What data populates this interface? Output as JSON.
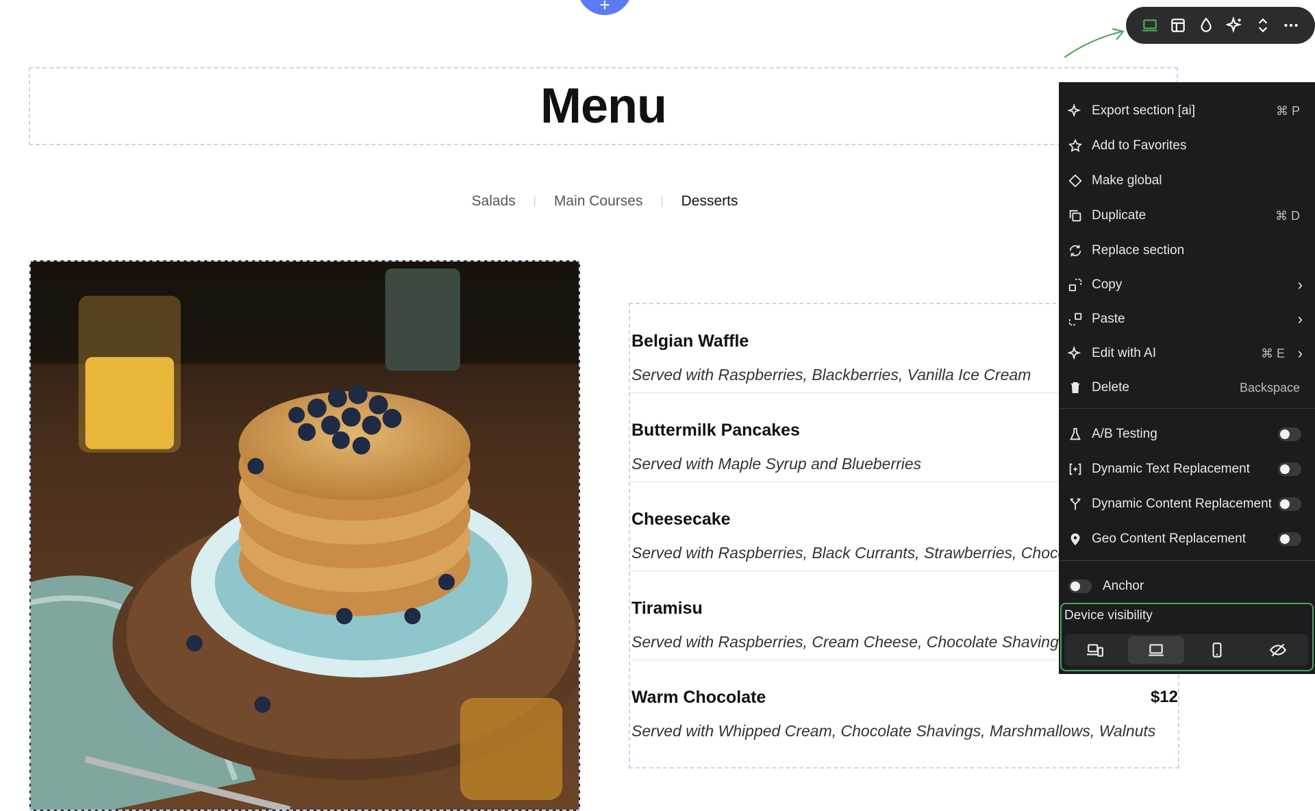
{
  "add_section": {
    "symbol": "+"
  },
  "menu_title": "Menu",
  "tabs": [
    {
      "label": "Salads",
      "active": false
    },
    {
      "label": "Main Courses",
      "active": false
    },
    {
      "label": "Desserts",
      "active": true
    }
  ],
  "tab_separator": "|",
  "image": {
    "subject": "stack of pancakes with blueberries and maple syrup, glass of orange juice"
  },
  "menu_items": [
    {
      "name": "Belgian Waffle",
      "price": "",
      "description": "Served with Raspberries, Blackberries, Vanilla Ice Cream"
    },
    {
      "name": "Buttermilk Pancakes",
      "price": "",
      "description": "Served with Maple Syrup and Blueberries"
    },
    {
      "name": "Cheesecake",
      "price": "",
      "description": "Served with Raspberries, Black Currants, Strawberries, Chocolat"
    },
    {
      "name": "Tiramisu",
      "price": "",
      "description": "Served with Raspberries, Cream Cheese, Chocolate Shavings"
    },
    {
      "name": "Warm Chocolate",
      "price": "$12",
      "description": "Served with Whipped Cream, Chocolate Shavings, Marshmallows, Walnuts"
    }
  ],
  "toolbar": {
    "buttons": [
      {
        "icon": "laptop-icon",
        "active": true
      },
      {
        "icon": "layout-icon",
        "active": false
      },
      {
        "icon": "droplet-icon",
        "active": false
      },
      {
        "icon": "sparkle-icon",
        "active": false
      },
      {
        "icon": "reorder-icon",
        "active": false
      },
      {
        "icon": "more-icon",
        "active": false
      }
    ],
    "active_color": "#4caf50"
  },
  "context_menu": {
    "items": [
      {
        "icon": "sparkle-icon",
        "label": "Export section [ai]",
        "shortcut": "⌘ P"
      },
      {
        "icon": "star-icon",
        "label": "Add to Favorites",
        "shortcut": ""
      },
      {
        "icon": "diamond-icon",
        "label": "Make global",
        "shortcut": ""
      },
      {
        "icon": "duplicate-icon",
        "label": "Duplicate",
        "shortcut": "⌘ D"
      },
      {
        "icon": "refresh-icon",
        "label": "Replace section",
        "shortcut": ""
      },
      {
        "icon": "copy-icon",
        "label": "Copy",
        "shortcut": "",
        "submenu": true
      },
      {
        "icon": "paste-icon",
        "label": "Paste",
        "shortcut": "",
        "submenu": true
      },
      {
        "icon": "sparkle-icon",
        "label": "Edit with AI",
        "shortcut": "⌘ E",
        "submenu": true
      },
      {
        "icon": "trash-icon",
        "label": "Delete",
        "shortcut": "Backspace"
      }
    ],
    "toggles": [
      {
        "icon": "flask-icon",
        "label": "A/B Testing",
        "on": false
      },
      {
        "icon": "bracket-icon",
        "label": "Dynamic Text Replacement",
        "on": false
      },
      {
        "icon": "branch-icon",
        "label": "Dynamic Content Replacement",
        "on": false
      },
      {
        "icon": "pin-icon",
        "label": "Geo Content Replacement",
        "on": false
      }
    ],
    "anchor": {
      "label": "Anchor",
      "on": false
    },
    "chevron": "›",
    "device_visibility": {
      "title": "Device visibility",
      "options": [
        {
          "icon": "all-devices-icon",
          "active": false
        },
        {
          "icon": "desktop-icon",
          "active": true
        },
        {
          "icon": "mobile-icon",
          "active": false
        },
        {
          "icon": "hidden-icon",
          "active": false
        }
      ],
      "accent": "#46a858"
    }
  }
}
